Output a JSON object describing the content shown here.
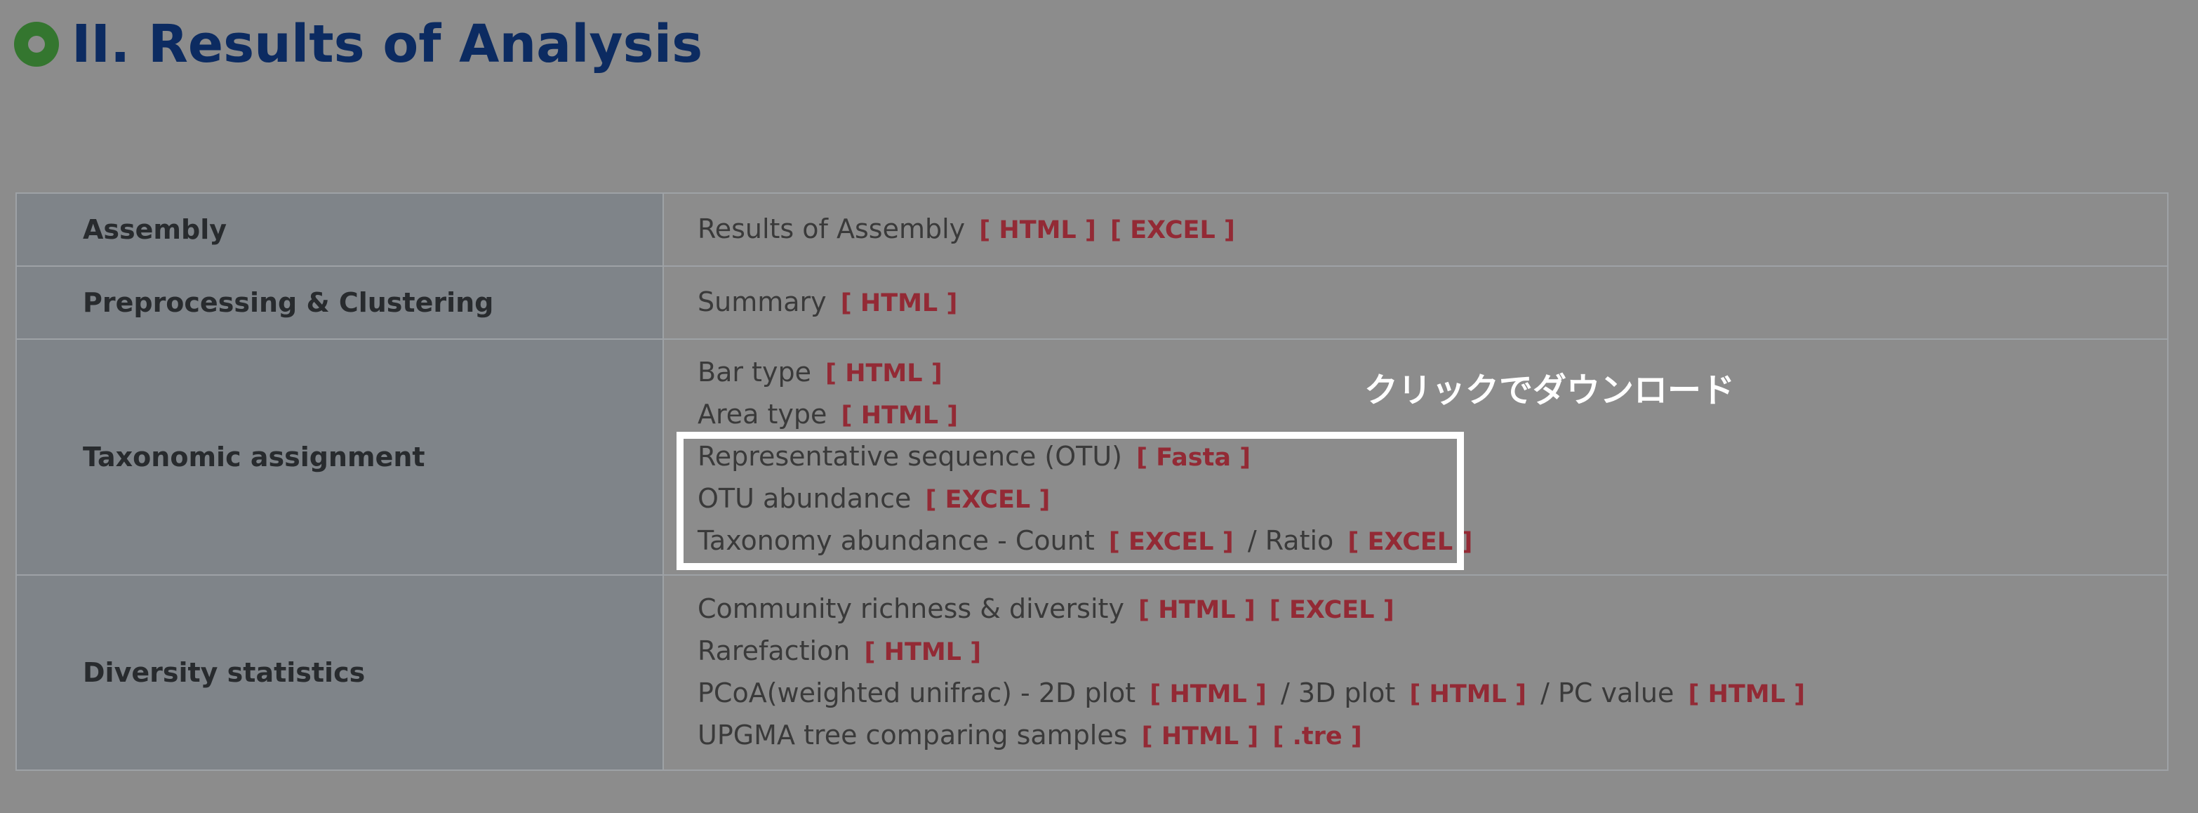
{
  "title": "II. Results of Analysis",
  "annotation": "クリックでダウンロード",
  "colors": {
    "background": "#8c8c8c",
    "title": "#0c2b61",
    "bullet": "#34762f",
    "link": "#932a35",
    "label_bg": "#7f8489",
    "highlight": "#ffffff"
  },
  "rows": [
    {
      "label": "Assembly",
      "lines": [
        {
          "text": "Results of Assembly",
          "links": [
            "[ HTML ]",
            "[ EXCEL ]"
          ]
        }
      ]
    },
    {
      "label": "Preprocessing & Clustering",
      "lines": [
        {
          "text": "Summary",
          "links": [
            "[ HTML ]"
          ]
        }
      ]
    },
    {
      "label": "Taxonomic assignment",
      "lines": [
        {
          "text": "Bar type",
          "links": [
            "[ HTML ]"
          ]
        },
        {
          "text": "Area type",
          "links": [
            "[ HTML ]"
          ]
        },
        {
          "text": "Representative sequence (OTU)",
          "links": [
            "[ Fasta ]"
          ]
        },
        {
          "text": "OTU abundance",
          "links": [
            "[ EXCEL ]"
          ]
        },
        {
          "text": "Taxonomy abundance - Count",
          "links": [
            "[ EXCEL ]"
          ],
          "sep": "/ Ratio",
          "links2": [
            "[ EXCEL ]"
          ]
        }
      ]
    },
    {
      "label": "Diversity statistics",
      "lines": [
        {
          "text": "Community richness & diversity",
          "links": [
            "[ HTML ]",
            "[ EXCEL ]"
          ]
        },
        {
          "text": "Rarefaction",
          "links": [
            "[ HTML ]"
          ]
        },
        {
          "text": "PCoA(weighted unifrac) - 2D plot",
          "links": [
            "[ HTML ]"
          ],
          "sep": "/ 3D plot",
          "links2": [
            "[ HTML ]"
          ],
          "sep2": "/ PC value",
          "links3": [
            "[ HTML ]"
          ]
        },
        {
          "text": "UPGMA tree comparing samples",
          "links": [
            "[ HTML ]",
            "[ .tre ]"
          ]
        }
      ]
    }
  ]
}
